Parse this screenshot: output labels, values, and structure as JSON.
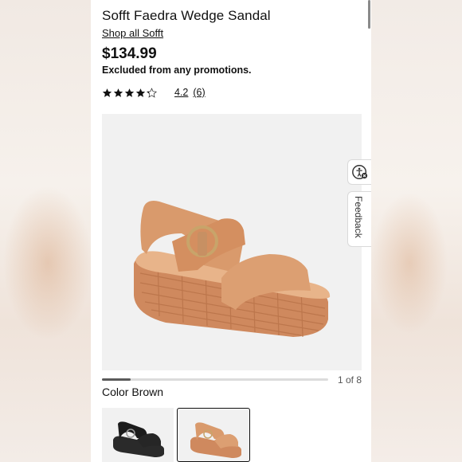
{
  "product": {
    "title": "Sofft Faedra Wedge Sandal",
    "shop_link": "Shop all Sofft",
    "price": "$134.99",
    "promo_note": "Excluded from any promotions.",
    "rating_value": "4.2",
    "rating_count": "(6)",
    "rating_score": 4.2,
    "rating_max": 5
  },
  "gallery": {
    "counter": "1 of 8",
    "current_index": 1,
    "total": 8
  },
  "color": {
    "label": "Color",
    "selected": "Brown"
  },
  "swatches": [
    {
      "name": "Black",
      "selected": false
    },
    {
      "name": "Brown",
      "selected": true
    }
  ],
  "side_tabs": {
    "feedback": "Feedback",
    "accessibility_icon": "accessibility-icon"
  },
  "colors": {
    "sandal_tan": "#d99a6c",
    "sandal_dark": "#b87248",
    "image_bg": "#f1f1f1",
    "text": "#111111"
  }
}
